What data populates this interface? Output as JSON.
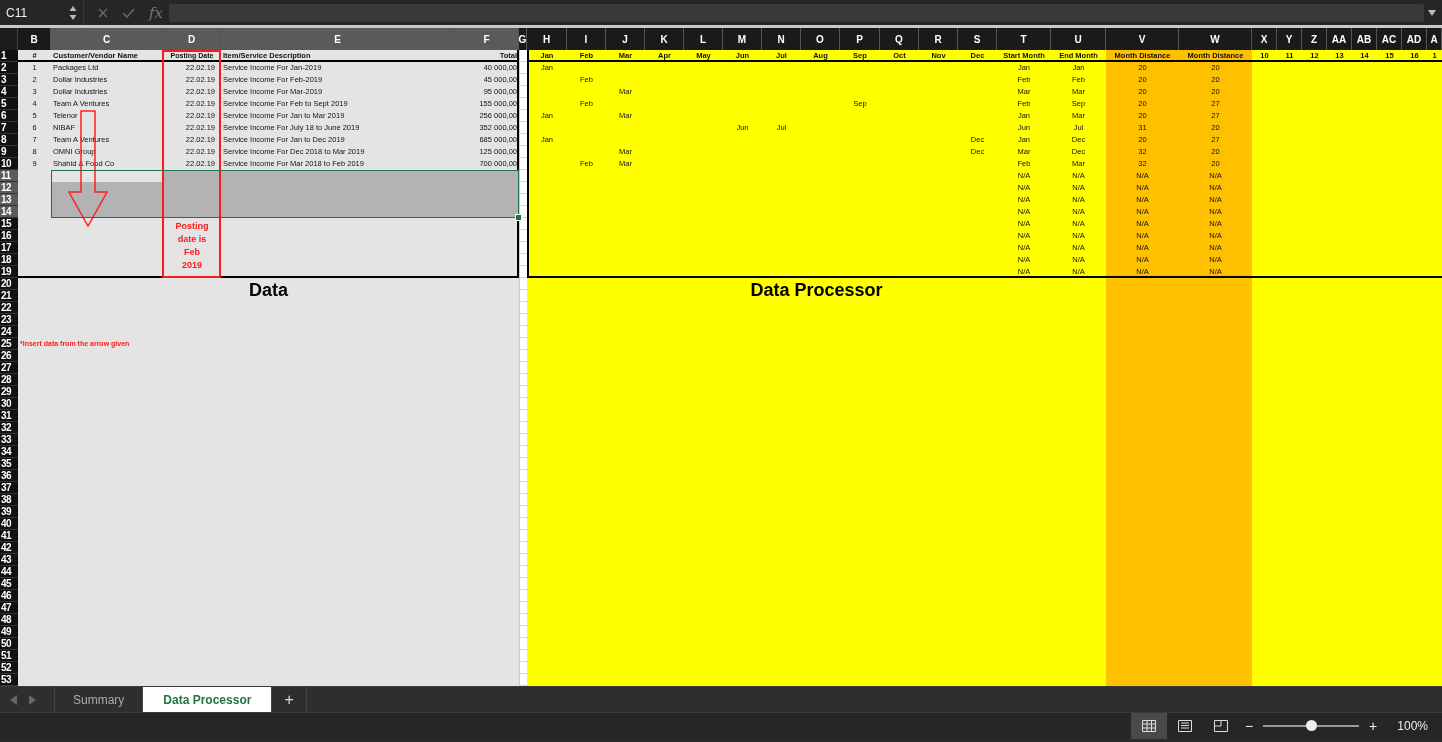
{
  "formula_bar": {
    "name_box": "C11",
    "function_label": "fx"
  },
  "column_headers": [
    {
      "label": "B",
      "selected": false
    },
    {
      "label": "C",
      "selected": true
    },
    {
      "label": "D",
      "selected": true
    },
    {
      "label": "E",
      "selected": true
    },
    {
      "label": "F",
      "selected": true
    },
    {
      "label": "G",
      "selected": false
    },
    {
      "label": "H",
      "selected": false
    },
    {
      "label": "I",
      "selected": false
    },
    {
      "label": "J",
      "selected": false
    },
    {
      "label": "K",
      "selected": false
    },
    {
      "label": "L",
      "selected": false
    },
    {
      "label": "M",
      "selected": false
    },
    {
      "label": "N",
      "selected": false
    },
    {
      "label": "O",
      "selected": false
    },
    {
      "label": "P",
      "selected": false
    },
    {
      "label": "Q",
      "selected": false
    },
    {
      "label": "R",
      "selected": false
    },
    {
      "label": "S",
      "selected": false
    },
    {
      "label": "T",
      "selected": false
    },
    {
      "label": "U",
      "selected": false
    },
    {
      "label": "V",
      "selected": false
    },
    {
      "label": "W",
      "selected": false
    },
    {
      "label": "X",
      "selected": false
    },
    {
      "label": "Y",
      "selected": false
    },
    {
      "label": "Z",
      "selected": false
    },
    {
      "label": "AA",
      "selected": false
    },
    {
      "label": "AB",
      "selected": false
    },
    {
      "label": "AC",
      "selected": false
    },
    {
      "label": "AD",
      "selected": false
    },
    {
      "label": "A",
      "selected": false
    }
  ],
  "row_headers": [
    {
      "label": "1",
      "selected": false
    },
    {
      "label": "2",
      "selected": false
    },
    {
      "label": "3",
      "selected": false
    },
    {
      "label": "4",
      "selected": false
    },
    {
      "label": "5",
      "selected": false
    },
    {
      "label": "6",
      "selected": false
    },
    {
      "label": "7",
      "selected": false
    },
    {
      "label": "8",
      "selected": false
    },
    {
      "label": "9",
      "selected": false
    },
    {
      "label": "10",
      "selected": false
    },
    {
      "label": "11",
      "selected": true
    },
    {
      "label": "12",
      "selected": true
    },
    {
      "label": "13",
      "selected": true
    },
    {
      "label": "14",
      "selected": true
    },
    {
      "label": "15",
      "selected": false
    },
    {
      "label": "16",
      "selected": false
    },
    {
      "label": "17",
      "selected": false
    },
    {
      "label": "18",
      "selected": false
    },
    {
      "label": "19",
      "selected": false
    },
    {
      "label": "20",
      "selected": false
    },
    {
      "label": "21",
      "selected": false
    },
    {
      "label": "22",
      "selected": false
    },
    {
      "label": "23",
      "selected": false
    },
    {
      "label": "24",
      "selected": false
    },
    {
      "label": "25",
      "selected": false
    },
    {
      "label": "26",
      "selected": false
    },
    {
      "label": "27",
      "selected": false
    },
    {
      "label": "28",
      "selected": false
    },
    {
      "label": "29",
      "selected": false
    },
    {
      "label": "30",
      "selected": false
    },
    {
      "label": "31",
      "selected": false
    },
    {
      "label": "32",
      "selected": false
    },
    {
      "label": "33",
      "selected": false
    },
    {
      "label": "34",
      "selected": false
    },
    {
      "label": "35",
      "selected": false
    },
    {
      "label": "36",
      "selected": false
    },
    {
      "label": "37",
      "selected": false
    },
    {
      "label": "38",
      "selected": false
    },
    {
      "label": "39",
      "selected": false
    },
    {
      "label": "40",
      "selected": false
    },
    {
      "label": "41",
      "selected": false
    },
    {
      "label": "42",
      "selected": false
    },
    {
      "label": "43",
      "selected": false
    },
    {
      "label": "44",
      "selected": false
    },
    {
      "label": "45",
      "selected": false
    },
    {
      "label": "46",
      "selected": false
    },
    {
      "label": "47",
      "selected": false
    },
    {
      "label": "48",
      "selected": false
    },
    {
      "label": "49",
      "selected": false
    },
    {
      "label": "50",
      "selected": false
    },
    {
      "label": "51",
      "selected": false
    },
    {
      "label": "52",
      "selected": false
    },
    {
      "label": "53",
      "selected": false
    }
  ],
  "data_table": {
    "title": "Data",
    "columns": [
      "#",
      "Customer/Vendor Name",
      "Posting Date",
      "Item/Service Description",
      "Total"
    ],
    "rows": [
      {
        "number": "1",
        "name": "Packages Ltd",
        "date": "22.02.19",
        "description": "Service Income For Jan-2019",
        "total": "40 000,00"
      },
      {
        "number": "2",
        "name": "Dollar Industries",
        "date": "22.02.19",
        "description": "Service Income For Feb-2019",
        "total": "45 000,00"
      },
      {
        "number": "3",
        "name": "Dollar Industries",
        "date": "22.02.19",
        "description": "Service Income For Mar-2019",
        "total": "95 000,00"
      },
      {
        "number": "4",
        "name": "Team A Ventures",
        "date": "22.02.19",
        "description": "Service Income For Feb to Sept 2019",
        "total": "155 000,00"
      },
      {
        "number": "5",
        "name": "Telenor",
        "date": "22.02.19",
        "description": "Service Income For Jan to Mar 2019",
        "total": "256 000,00"
      },
      {
        "number": "6",
        "name": "NIBAF",
        "date": "22.02.19",
        "description": "Service Income For July 18 to June 2019",
        "total": "352 000,00"
      },
      {
        "number": "7",
        "name": "Team A Ventures",
        "date": "22.02.19",
        "description": "Service Income For Jan to Dec 2019",
        "total": "685 000,00"
      },
      {
        "number": "8",
        "name": "OMNI Group",
        "date": "22.02.19",
        "description": "Service Income For Dec 2018 to Mar 2019",
        "total": "125 000,00"
      },
      {
        "number": "9",
        "name": "Shahid & Food Co",
        "date": "22.02.19",
        "description": "Service Income For Mar 2018 to Feb 2019",
        "total": "700 000,00"
      }
    ],
    "posting_note": "Posting date is Feb 2019",
    "insert_note": "*Insert data from the arrow given"
  },
  "processor": {
    "title": "Data Processor",
    "month_headers": [
      "Jan",
      "Feb",
      "Mar",
      "Apr",
      "May",
      "Jun",
      "Jul",
      "Aug",
      "Sep",
      "Oct",
      "Nov",
      "Dec"
    ],
    "start_header": "Start Month",
    "end_header": "End Month",
    "distance_headers": [
      "Month Distance",
      "Month Distance"
    ],
    "number_headers": [
      "10",
      "11",
      "12",
      "13",
      "14",
      "15",
      "16",
      "1"
    ],
    "rows": [
      {
        "months": {
          "jan": "Jan"
        },
        "start": "Jan",
        "end": "Jan",
        "distance_1": "20",
        "distance_2": "20"
      },
      {
        "months": {
          "feb": "Feb"
        },
        "start": "Feb",
        "end": "Feb",
        "distance_1": "20",
        "distance_2": "20"
      },
      {
        "months": {
          "mar": "Mar"
        },
        "start": "Mar",
        "end": "Mar",
        "distance_1": "20",
        "distance_2": "20"
      },
      {
        "months": {
          "feb": "Feb",
          "sep": "Sep"
        },
        "start": "Feb",
        "end": "Sep",
        "distance_1": "20",
        "distance_2": "27"
      },
      {
        "months": {
          "jan": "Jan",
          "mar": "Mar"
        },
        "start": "Jan",
        "end": "Mar",
        "distance_1": "20",
        "distance_2": "27"
      },
      {
        "months": {
          "jun": "Jun",
          "jul": "Jul"
        },
        "start": "Jun",
        "end": "Jul",
        "distance_1": "31",
        "distance_2": "20"
      },
      {
        "months": {
          "jan": "Jan",
          "dec": "Dec"
        },
        "start": "Jan",
        "end": "Dec",
        "distance_1": "20",
        "distance_2": "27"
      },
      {
        "months": {
          "mar": "Mar",
          "dec": "Dec"
        },
        "start": "Mar",
        "end": "Dec",
        "distance_1": "32",
        "distance_2": "20"
      },
      {
        "months": {
          "feb": "Feb",
          "mar": "Mar"
        },
        "start": "Feb",
        "end": "Mar",
        "distance_1": "32",
        "distance_2": "20"
      },
      {
        "start": "N/A",
        "end": "N/A",
        "distance_1": "N/A",
        "distance_2": "N/A"
      },
      {
        "start": "N/A",
        "end": "N/A",
        "distance_1": "N/A",
        "distance_2": "N/A"
      },
      {
        "start": "N/A",
        "end": "N/A",
        "distance_1": "N/A",
        "distance_2": "N/A"
      },
      {
        "start": "N/A",
        "end": "N/A",
        "distance_1": "N/A",
        "distance_2": "N/A"
      },
      {
        "start": "N/A",
        "end": "N/A",
        "distance_1": "N/A",
        "distance_2": "N/A"
      },
      {
        "start": "N/A",
        "end": "N/A",
        "distance_1": "N/A",
        "distance_2": "N/A"
      },
      {
        "start": "N/A",
        "end": "N/A",
        "distance_1": "N/A",
        "distance_2": "N/A"
      },
      {
        "start": "N/A",
        "end": "N/A",
        "distance_1": "N/A",
        "distance_2": "N/A"
      },
      {
        "start": "N/A",
        "end": "N/A",
        "distance_1": "N/A",
        "distance_2": "N/A"
      }
    ]
  },
  "sheet_tabs": [
    {
      "label": "Summary",
      "selected": false
    },
    {
      "label": "Data Processor",
      "selected": true
    }
  ],
  "add_sheet": "+",
  "status_bar": {
    "views": [
      {
        "kind": "normal",
        "selected": true
      },
      {
        "kind": "page_layout",
        "selected": false
      },
      {
        "kind": "page_break",
        "selected": false
      }
    ],
    "zoom_out": "−",
    "zoom_in": "+",
    "zoom": {
      "level": 0.5,
      "label": "100%"
    }
  }
}
